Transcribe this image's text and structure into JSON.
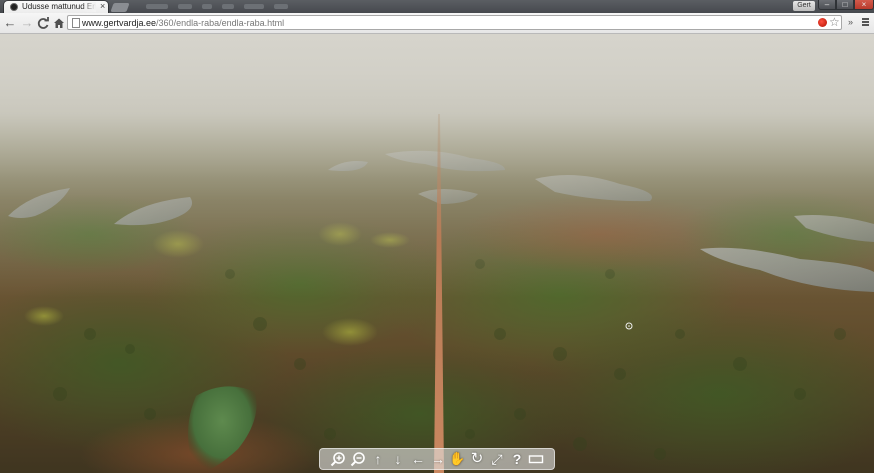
{
  "browser": {
    "tab": {
      "title": "Udusse mattunud Endla r",
      "close_glyph": "×"
    },
    "profile_badge": "Gert",
    "window_controls": {
      "minimize": "–",
      "maximize": "□",
      "close": "×"
    },
    "toolbar": {
      "back_glyph": "←",
      "forward_glyph": "→",
      "reload_glyph": "C",
      "home_glyph": "⌂",
      "url_host": "www.gertvardja.ee",
      "url_path": "/360/endla-raba/endla-raba.html",
      "bookmark_glyph": "☆",
      "overflow_glyph": "»"
    }
  },
  "icons": {
    "favicon": "favicon-icon",
    "page": "page-icon",
    "extension": "red-extension-icon",
    "menu": "hamburger-menu-icon"
  },
  "panorama_controls": [
    {
      "name": "zoom-in-icon",
      "glyph": ""
    },
    {
      "name": "zoom-out-icon",
      "glyph": ""
    },
    {
      "name": "pan-up-icon",
      "glyph": "↑"
    },
    {
      "name": "pan-down-icon",
      "glyph": "↓"
    },
    {
      "name": "pan-left-icon",
      "glyph": "←"
    },
    {
      "name": "pan-right-icon",
      "glyph": "→"
    },
    {
      "name": "drag-hand-icon",
      "glyph": "✋"
    },
    {
      "name": "autorotate-icon",
      "glyph": "↻"
    },
    {
      "name": "fullscreen-icon",
      "glyph": "⤢"
    },
    {
      "name": "help-icon",
      "glyph": "?"
    },
    {
      "name": "hide-controls-icon",
      "glyph": ""
    }
  ],
  "colors": {
    "fog": "#d3d1c9",
    "bog": "#6a5534",
    "pond": "#9aa09a",
    "boardwalk": "#c47b5a"
  }
}
